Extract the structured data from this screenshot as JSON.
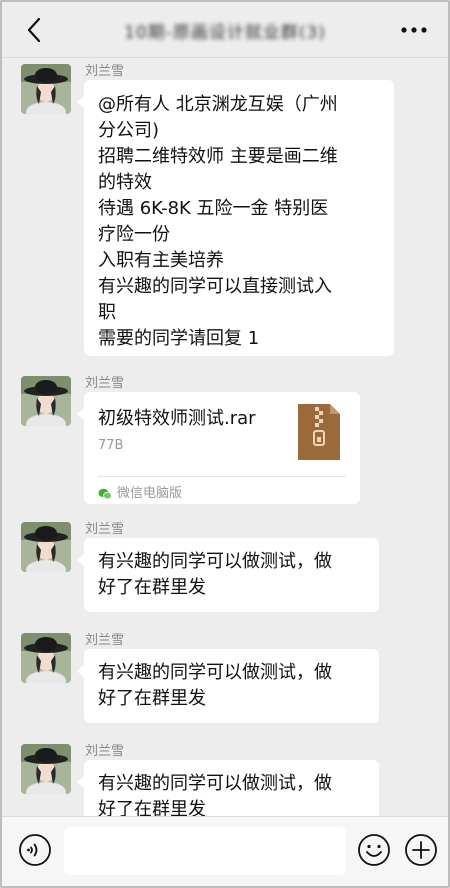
{
  "header": {
    "title": "10期-原画设计就业群(3)",
    "back_icon": "chevron-left-icon",
    "more_icon": "more-horizontal-icon"
  },
  "messages": [
    {
      "sender": "刘兰雪",
      "type": "text",
      "lines": [
        "@所有人  北京渊龙互娱（广州",
        "分公司)",
        "招聘二维特效师   主要是画二维",
        "的特效",
        "待遇 6K-8K  五险一金  特别医",
        "疗险一份",
        "入职有主美培养",
        "有兴趣的同学可以直接测试入",
        "职",
        "需要的同学请回复  1"
      ]
    },
    {
      "sender": "刘兰雪",
      "type": "file",
      "file_name": "初级特效师测试.rar",
      "file_size": "77B",
      "source": "微信电脑版",
      "file_icon": "zip-archive-icon",
      "source_icon": "wechat-icon"
    },
    {
      "sender": "刘兰雪",
      "type": "text",
      "lines": [
        "有兴趣的同学可以做测试，做",
        "好了在群里发"
      ]
    },
    {
      "sender": "刘兰雪",
      "type": "text",
      "lines": [
        "有兴趣的同学可以做测试，做",
        "好了在群里发"
      ]
    },
    {
      "sender": "刘兰雪",
      "type": "text",
      "lines": [
        "有兴趣的同学可以做测试，做",
        "好了在群里发"
      ]
    }
  ],
  "input_bar": {
    "value": "",
    "placeholder": "",
    "voice_icon": "voice-icon",
    "emoji_icon": "emoji-icon",
    "plus_icon": "plus-circle-icon"
  },
  "colors": {
    "background": "#ededed",
    "bubble": "#ffffff",
    "file_icon": "#9b6a3a",
    "wechat_green": "#3cb034"
  }
}
